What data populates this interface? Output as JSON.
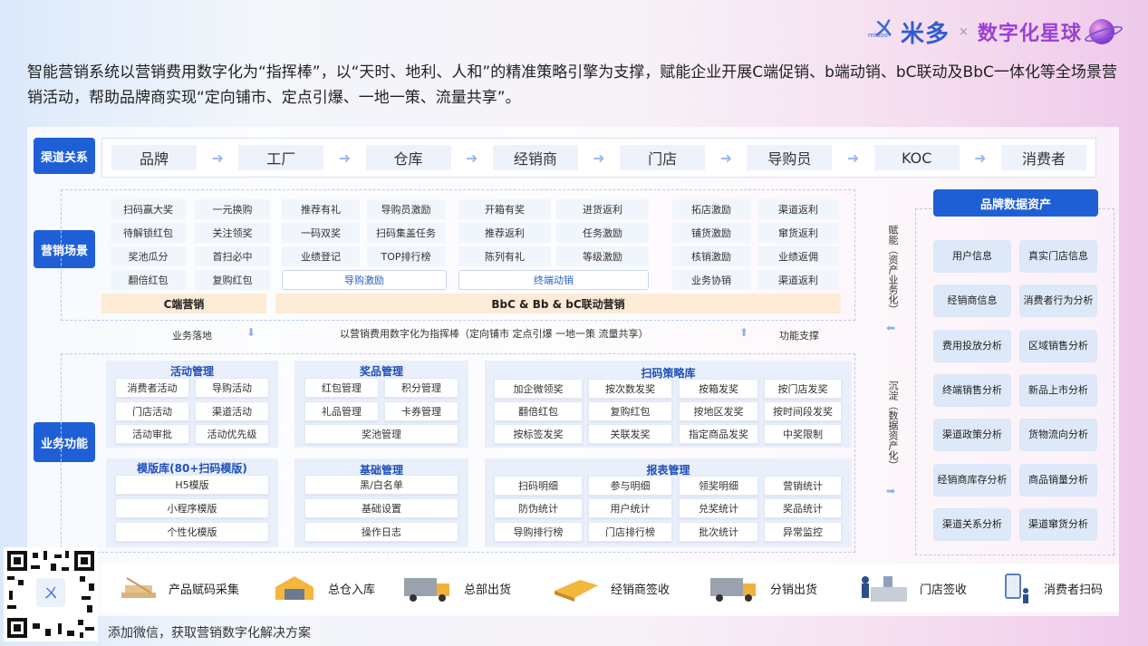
{
  "brand": {
    "logo_small": "midoo",
    "name": "米多",
    "separator": "×",
    "name2": "数字化星球"
  },
  "intro": "智能营销系统以营销费用数字化为“指挥棒”，以“天时、地利、人和”的精准策略引擎为支撑，赋能企业开展C端促销、b端动销、bC联动及BbC一体化等全场景营销活动，帮助品牌商实现“定向铺市、定点引爆、一地一策、流量共享”。",
  "sections": {
    "channel": "渠道关系",
    "marketing": "营销场景",
    "business": "业务功能"
  },
  "channels": [
    "品牌",
    "工厂",
    "仓库",
    "经销商",
    "门店",
    "导购员",
    "KOC",
    "消费者"
  ],
  "scenes": {
    "c_grid": [
      [
        "扫码赢大奖",
        "一元换购"
      ],
      [
        "待解锁红包",
        "关注领奖"
      ],
      [
        "奖池瓜分",
        "首扫必中"
      ],
      [
        "翻倍红包",
        "复购红包"
      ]
    ],
    "c_label": "C端营销",
    "g_grid": [
      [
        "推荐有礼",
        "导购员激励"
      ],
      [
        "一码双奖",
        "扫码集盖任务"
      ],
      [
        "业绩登记",
        "TOP排行榜"
      ]
    ],
    "g_label": "导购激励",
    "t_grid": [
      [
        "开箱有奖",
        "进货返利"
      ],
      [
        "推荐返利",
        "任务激励"
      ],
      [
        "陈列有礼",
        "等级激励"
      ]
    ],
    "t_label": "终端动销",
    "s_grid": [
      [
        "拓店激励",
        "渠道返利"
      ],
      [
        "铺货激励",
        "窜货返利"
      ],
      [
        "核销激励",
        "业绩返佣"
      ],
      [
        "业务协销",
        "渠道返利"
      ]
    ],
    "bbc_label": "BbC & Bb & bC联动营销"
  },
  "middle": {
    "left": "业务落地",
    "center": "以营销费用数字化为指挥棒（定向铺市 定点引爆 一地一策 流量共享）",
    "right": "功能支撑"
  },
  "vertical": {
    "top": "赋能（资产业务化）",
    "bottom": "沉淀（数据资产化）"
  },
  "functions": {
    "activity": {
      "title": "活动管理",
      "items": [
        [
          "消费者活动",
          "导购活动"
        ],
        [
          "门店活动",
          "渠道活动"
        ],
        [
          "活动审批",
          "活动优先级"
        ]
      ]
    },
    "prize": {
      "title": "奖品管理",
      "items": [
        [
          "红包管理",
          "积分管理"
        ],
        [
          "礼品管理",
          "卡券管理"
        ]
      ],
      "single": "奖池管理"
    },
    "scan": {
      "title": "扫码策略库",
      "items": [
        [
          "加企微领奖",
          "按次数发奖",
          "按箱发奖",
          "按门店发奖"
        ],
        [
          "翻倍红包",
          "复购红包",
          "按地区发奖",
          "按时间段发奖"
        ],
        [
          "按标签发奖",
          "关联发奖",
          "指定商品发奖",
          "中奖限制"
        ]
      ]
    },
    "template": {
      "title": "模版库(80+扫码模版)",
      "items": [
        "H5模版",
        "小程序模版",
        "个性化模版"
      ]
    },
    "base": {
      "title": "基础管理",
      "items": [
        "黑/白名单",
        "基础设置",
        "操作日志"
      ]
    },
    "report": {
      "title": "报表管理",
      "items": [
        [
          "扫码明细",
          "参与明细",
          "领奖明细",
          "营销统计"
        ],
        [
          "防伪统计",
          "用户统计",
          "兑奖统计",
          "奖品统计"
        ],
        [
          "导购排行榜",
          "门店排行榜",
          "批次统计",
          "异常监控"
        ]
      ]
    }
  },
  "assets": {
    "title": "品牌数据资产",
    "items": [
      [
        "用户信息",
        "真实门店信息"
      ],
      [
        "经销商信息",
        "消费者行为分析"
      ],
      [
        "费用投放分析",
        "区域销售分析"
      ],
      [
        "终端销售分析",
        "新品上市分析"
      ],
      [
        "渠道政策分析",
        "货物流向分析"
      ],
      [
        "经销商库存分析",
        "商品销量分析"
      ],
      [
        "渠道关系分析",
        "渠道窜货分析"
      ]
    ]
  },
  "flow": [
    "产品赋码采集",
    "总仓入库",
    "总部出货",
    "经销商签收",
    "分销出货",
    "门店签收",
    "消费者扫码"
  ],
  "footer": "添加微信，获取营销数字化解决方案",
  "colors": {
    "primary": "#1f5fd6",
    "title_blue": "#1f4fb8",
    "orange_bar": "#fdebd6",
    "panel": "#e9f0fb"
  }
}
